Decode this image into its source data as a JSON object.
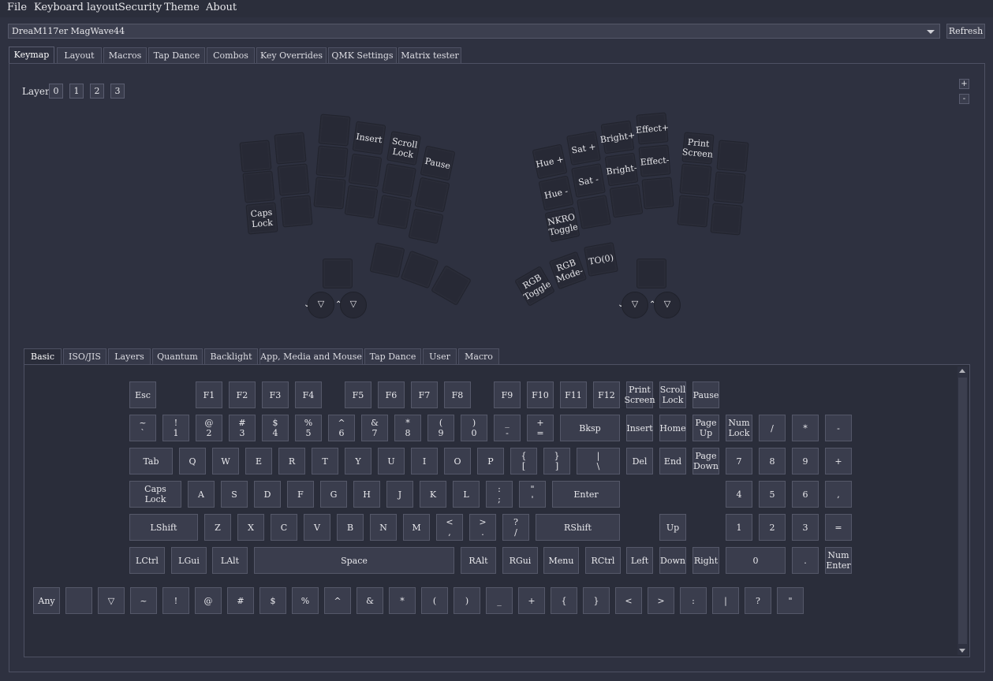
{
  "menu": [
    "File",
    "Keyboard layout",
    "Security",
    "Theme",
    "About"
  ],
  "device": {
    "selected": "DreaM117er MagWave44",
    "refresh_label": "Refresh"
  },
  "main_tabs": [
    "Keymap",
    "Layout",
    "Macros",
    "Tap Dance",
    "Combos",
    "Key Overrides",
    "QMK Settings",
    "Matrix tester"
  ],
  "layer": {
    "label": "Layer",
    "options": [
      "0",
      "1",
      "2",
      "3"
    ]
  },
  "zoom": {
    "in": "+",
    "out": "-"
  },
  "keyboard_keys": [
    "",
    "",
    "Caps\nLock",
    "",
    "",
    "",
    "",
    "",
    "",
    "Insert",
    "",
    "",
    "Scroll\nLock",
    "",
    "",
    "Pause",
    "",
    "",
    "",
    "",
    "",
    "",
    "Hue +",
    "Hue -",
    "NKRO\nToggle",
    "Sat +",
    "Sat -",
    "",
    "Bright+",
    "Bright-",
    "",
    "Effect+",
    "Effect-",
    "",
    "",
    "",
    "",
    "Print\nScreen",
    "",
    "",
    "",
    "",
    "",
    "",
    "RGB\nToggle",
    "RGB\nMode-",
    "TO(0)",
    ""
  ],
  "encoders": [
    "▽",
    "▽",
    "▽",
    "▽"
  ],
  "encoder_arrows": [
    "⌄",
    "⌃",
    "⌄",
    "⌃"
  ],
  "bottom_tabs": [
    "Basic",
    "ISO/JIS",
    "Layers",
    "Quantum",
    "Backlight",
    "App, Media and Mouse",
    "Tap Dance",
    "User",
    "Macro"
  ],
  "palette": {
    "row0": [
      "Esc",
      "F1",
      "F2",
      "F3",
      "F4",
      "F5",
      "F6",
      "F7",
      "F8",
      "F9",
      "F10",
      "F11",
      "F12",
      "Print\nScreen",
      "Scroll\nLock",
      "Pause"
    ],
    "row1": [
      "~\n`",
      "!\n1",
      "@\n2",
      "#\n3",
      "$\n4",
      "%\n5",
      "^\n6",
      "&\n7",
      "*\n8",
      "(\n9",
      ")\n0",
      "_\n-",
      "+\n=",
      "Bksp",
      "Insert",
      "Home",
      "Page\nUp",
      "Num\nLock",
      "/",
      "*",
      "-"
    ],
    "row2": [
      "Tab",
      "Q",
      "W",
      "E",
      "R",
      "T",
      "Y",
      "U",
      "I",
      "O",
      "P",
      "{\n[",
      "}\n]",
      "|\n\\",
      "Del",
      "End",
      "Page\nDown",
      "7",
      "8",
      "9",
      "+"
    ],
    "row3": [
      "Caps\nLock",
      "A",
      "S",
      "D",
      "F",
      "G",
      "H",
      "J",
      "K",
      "L",
      ":\n;",
      "\"\n'",
      "Enter",
      "4",
      "5",
      "6",
      ","
    ],
    "row4": [
      "LShift",
      "Z",
      "X",
      "C",
      "V",
      "B",
      "N",
      "M",
      "<\n,",
      ">\n.",
      "?\n/",
      "RShift",
      "Up",
      "1",
      "2",
      "3",
      "="
    ],
    "row5": [
      "LCtrl",
      "LGui",
      "LAlt",
      "Space",
      "RAlt",
      "RGui",
      "Menu",
      "RCtrl",
      "Left",
      "Down",
      "Right",
      "0",
      ".",
      "Num\nEnter"
    ],
    "row6": [
      "Any",
      "",
      "▽",
      "~",
      "!",
      "@",
      "#",
      "$",
      "%",
      "^",
      "&",
      "*",
      "(",
      ")",
      "_",
      "+",
      "{",
      "}",
      "<",
      ">",
      ":",
      "|",
      "?",
      "\""
    ]
  }
}
